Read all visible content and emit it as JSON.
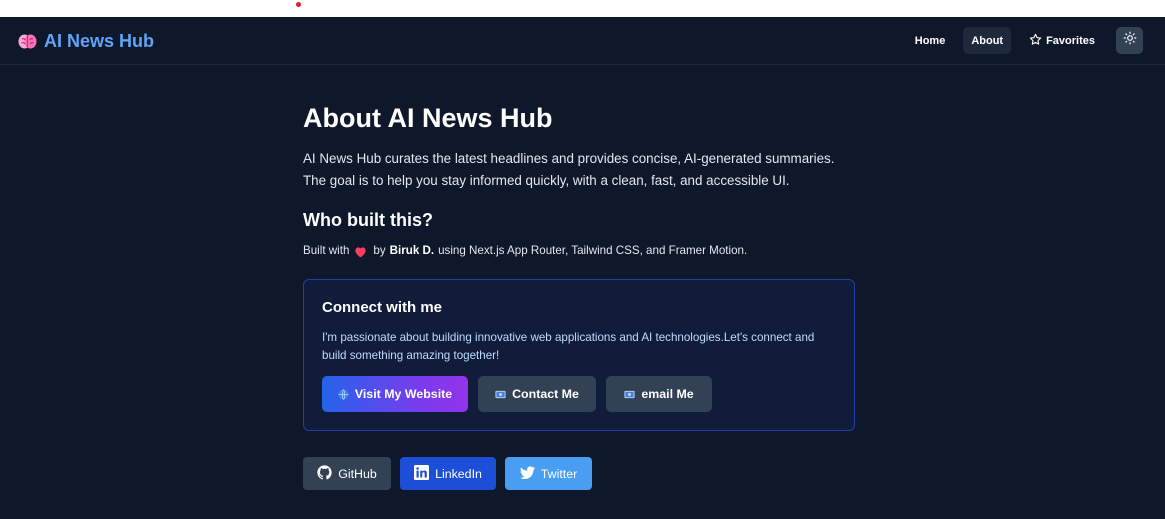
{
  "colors": {
    "page_bg": "#0f172a",
    "brand": "#60a5fa",
    "card_bg": "#111c3b",
    "card_border": "#1e40af",
    "button_gray": "#334155",
    "gradient_start": "#2563eb",
    "gradient_end": "#9333ea",
    "linkedin": "#1d4ed8",
    "twitter": "#4a9ef2"
  },
  "navbar": {
    "brand_icon": "brain-icon",
    "brand_text": "AI News Hub",
    "links": {
      "home": "Home",
      "about": "About",
      "favorites": "Favorites"
    },
    "favorites_icon": "star-icon",
    "theme_icon": "sun-icon",
    "active_link": "About"
  },
  "about": {
    "title": "About AI News Hub",
    "intro_line1": "AI News Hub curates the latest headlines and provides concise, AI-generated summaries.",
    "intro_line2": "The goal is to help you stay informed quickly, with a clean, fast, and accessible UI.",
    "who_heading": "Who built this?",
    "built_prefix": "Built with",
    "built_icon": "heart-icon",
    "built_by": "by",
    "built_name": "Biruk D.",
    "built_suffix": "using Next.js App Router, Tailwind CSS, and Framer Motion."
  },
  "connect": {
    "title": "Connect with me",
    "text": "I'm passionate about building innovative web applications and AI technologies.Let's connect and build something amazing together!",
    "buttons": {
      "website": "Visit My Website",
      "contact": "Contact Me",
      "email": "email Me"
    },
    "icons": {
      "website": "globe-icon",
      "contact": "contact-card-icon",
      "email": "email-icon"
    }
  },
  "socials": {
    "github": "GitHub",
    "linkedin": "LinkedIn",
    "twitter": "Twitter"
  }
}
